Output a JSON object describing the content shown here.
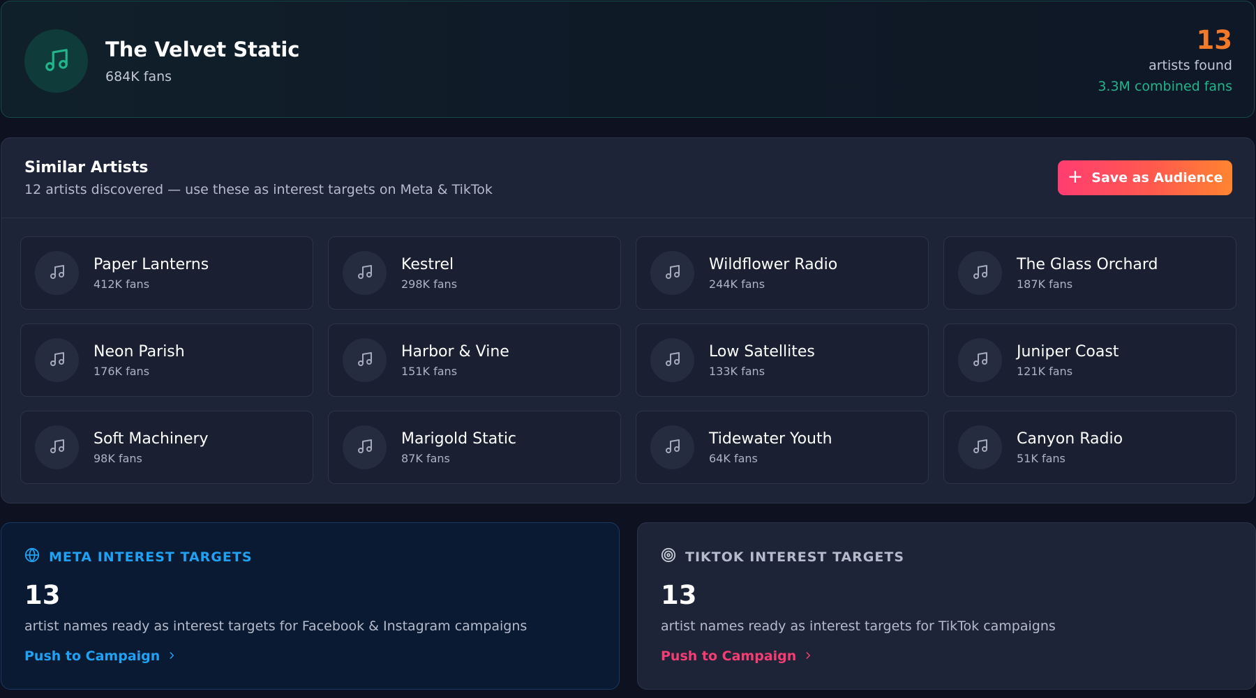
{
  "header": {
    "artist_name": "The Velvet Static",
    "artist_fans": "684K fans",
    "stats": {
      "count": "13",
      "count_label": "artists found",
      "combined_fans": "3.3M combined fans"
    },
    "icon": "music-note-icon",
    "accent_color": "#21b58b"
  },
  "similar": {
    "title": "Similar Artists",
    "subtitle": "12 artists discovered — use these as interest targets on Meta & TikTok",
    "save_button": {
      "icon": "+",
      "label": "Save as Audience"
    },
    "artists": [
      {
        "name": "Paper Lanterns",
        "fans": "412K fans"
      },
      {
        "name": "Kestrel",
        "fans": "298K fans"
      },
      {
        "name": "Wildflower Radio",
        "fans": "244K fans"
      },
      {
        "name": "The Glass Orchard",
        "fans": "187K fans"
      },
      {
        "name": "Neon Parish",
        "fans": "176K fans"
      },
      {
        "name": "Harbor & Vine",
        "fans": "151K fans"
      },
      {
        "name": "Low Satellites",
        "fans": "133K fans"
      },
      {
        "name": "Juniper Coast",
        "fans": "121K fans"
      },
      {
        "name": "Soft Machinery",
        "fans": "98K fans"
      },
      {
        "name": "Marigold Static",
        "fans": "87K fans"
      },
      {
        "name": "Tidewater Youth",
        "fans": "64K fans"
      },
      {
        "name": "Canyon Radio",
        "fans": "51K fans"
      }
    ]
  },
  "targets": {
    "meta": {
      "title": "META INTEREST TARGETS",
      "icon": "globe-icon",
      "count": "13",
      "description": "artist names ready as interest targets for Facebook & Instagram campaigns",
      "link": "Push to Campaign",
      "color": "#1fa2f3"
    },
    "tiktok": {
      "title": "TIKTOK INTEREST TARGETS",
      "icon": "target-icon",
      "count": "13",
      "description": "artist names ready as interest targets for TikTok campaigns",
      "link": "Push to Campaign",
      "color": "#f43d72"
    }
  }
}
